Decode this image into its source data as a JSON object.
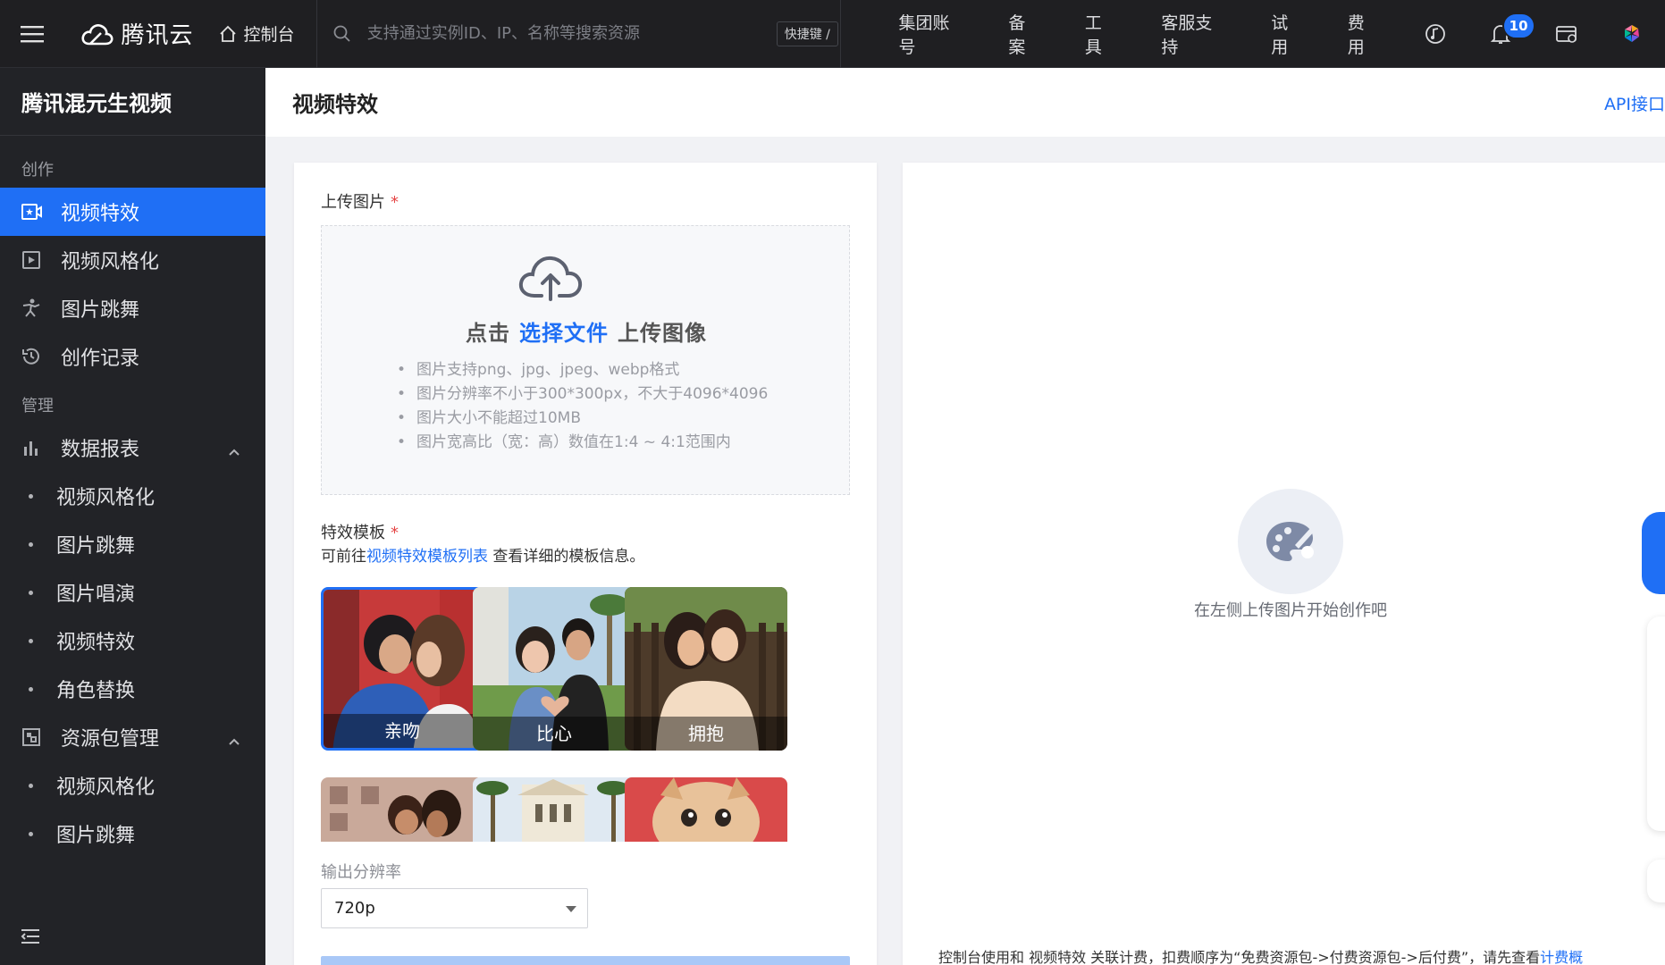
{
  "topbar": {
    "logo_text": "腾讯云",
    "console_label": "控制台",
    "search_placeholder": "支持通过实例ID、IP、名称等搜索资源",
    "shortcut_label": "快捷键 /",
    "nav": [
      "集团账号",
      "备案",
      "工具",
      "客服支持",
      "试用",
      "费用"
    ],
    "notification_count": "10"
  },
  "sidebar": {
    "title": "腾讯混元生视频",
    "group_create": "创作",
    "create_items": [
      {
        "label": "视频特效",
        "icon": "video-effects-icon",
        "active": true
      },
      {
        "label": "视频风格化",
        "icon": "video-style-icon"
      },
      {
        "label": "图片跳舞",
        "icon": "dance-icon"
      },
      {
        "label": "创作记录",
        "icon": "history-icon"
      }
    ],
    "group_manage": "管理",
    "data_report": {
      "label": "数据报表",
      "subitems": [
        "视频风格化",
        "图片跳舞",
        "图片唱演",
        "视频特效",
        "角色替换"
      ]
    },
    "resource_pack": {
      "label": "资源包管理",
      "subitems": [
        "视频风格化",
        "图片跳舞"
      ]
    }
  },
  "page": {
    "title": "视频特效",
    "api_link": "API接口"
  },
  "form": {
    "upload_label": "上传图片",
    "required_mark": "*",
    "upload_cta_prefix": "点击",
    "upload_cta_link": "选择文件",
    "upload_cta_suffix": "上传图像",
    "rules": [
      "图片支持png、jpg、jpeg、webp格式",
      "图片分辨率不小于300*300px，不大于4096*4096",
      "图片大小不能超过10MB",
      "图片宽高比（宽：高）数值在1:4 ~ 4:1范围内"
    ],
    "template_label": "特效模板",
    "template_hint_prefix": "可前往",
    "template_hint_link": "视频特效模板列表",
    "template_hint_suffix": " 查看详细的模板信息。",
    "templates": [
      {
        "label": "亲吻",
        "selected": true
      },
      {
        "label": "比心"
      },
      {
        "label": "拥抱"
      },
      {
        "label": ""
      },
      {
        "label": ""
      },
      {
        "label": ""
      }
    ],
    "resolution_label": "输出分辨率",
    "resolution_value": "720p"
  },
  "preview": {
    "empty_text": "在左侧上传图片开始创作吧",
    "billing_text": "控制台使用和 视频特效 关联计费，扣费顺序为“免费资源包->付费资源包->后付费”，请先查看",
    "billing_link": "计费概"
  },
  "colors": {
    "accent": "#1f6ff5",
    "topbar_bg": "#1f1f22",
    "sidebar_bg": "#222327"
  }
}
